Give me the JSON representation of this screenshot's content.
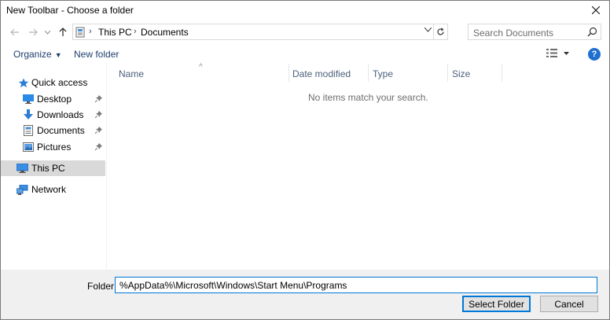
{
  "window": {
    "title": "New Toolbar - Choose a folder"
  },
  "address": {
    "crumbs": [
      "This PC",
      "Documents"
    ]
  },
  "search": {
    "placeholder": "Search Documents"
  },
  "toolbar": {
    "organize_label": "Organize",
    "new_folder_label": "New folder"
  },
  "nav": {
    "quick_access": "Quick access",
    "items": [
      {
        "label": "Desktop",
        "pinned": true
      },
      {
        "label": "Downloads",
        "pinned": true
      },
      {
        "label": "Documents",
        "pinned": true
      },
      {
        "label": "Pictures",
        "pinned": true
      }
    ],
    "this_pc": "This PC",
    "network": "Network"
  },
  "columns": [
    "Name",
    "Date modified",
    "Type",
    "Size"
  ],
  "empty_message": "No items match your search.",
  "footer": {
    "folder_label": "Folder:",
    "folder_value": "%AppData%\\Microsoft\\Windows\\Start Menu\\Programs",
    "select_button": "Select Folder",
    "cancel_button": "Cancel"
  },
  "colors": {
    "accent": "#0078d7",
    "selection": "#d9d9d9",
    "footer_bg": "#f0f0f0"
  }
}
